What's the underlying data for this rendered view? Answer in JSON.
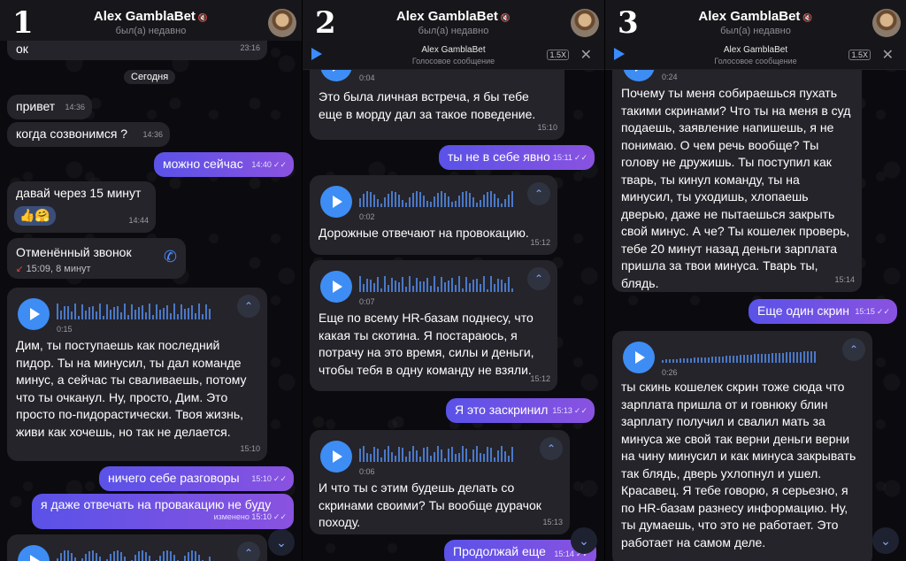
{
  "header": {
    "name": "Alex GamblaBet",
    "status": "был(а) недавно"
  },
  "player": {
    "title": "Alex GamblaBet",
    "subtitle": "Голосовое сообщение",
    "speed": "1.5X"
  },
  "panels": {
    "p1": "1",
    "p2": "2",
    "p3": "3"
  },
  "p1": {
    "m0": {
      "text": "ок",
      "time": "23:16"
    },
    "date": "Сегодня",
    "m1": {
      "text": "привет",
      "time": "14:36"
    },
    "m2": {
      "text": "когда созвонимся ?",
      "time": "14:36"
    },
    "m3": {
      "text": "можно сейчас",
      "time": "14:40"
    },
    "m4": {
      "text": "давай через 15 минут",
      "reactions": "👍🤗",
      "time": "14:44"
    },
    "call": {
      "title": "Отменённый звонок",
      "detail": "15:09, 8 минут"
    },
    "v1": {
      "duration": "0:15",
      "text": "Дим, ты поступаешь как последний пидор. Ты на минусил, ты дал команде минус, а сейчас ты сваливаешь, потому что ты очканул. Ну, просто, Дим. Это просто по-пидорастически. Твоя жизнь, живи как хочешь, но так не делается.",
      "time": "15:10"
    },
    "m5": {
      "text": "ничего себе разговоры",
      "time": "15:10"
    },
    "m6": {
      "text": "я даже отвечать на провакацию не буду",
      "time": "изменено 15:10"
    }
  },
  "p2": {
    "v0": {
      "duration": "0:04",
      "text": "Это была личная встреча, я бы тебе еще в морду дал за такое поведение.",
      "time": "15:10"
    },
    "m1": {
      "text": "ты не в себе явно",
      "time": "15:11"
    },
    "v1": {
      "duration": "0:02",
      "text": "Дорожные отвечают на провокацию.",
      "time": "15:12"
    },
    "v2": {
      "duration": "0:07",
      "text": "Еще по всему HR-базам поднесу, что какая ты скотина. Я постараюсь, я потрачу на это время, силы и деньги, чтобы тебя в одну команду не взяли.",
      "time": "15:12"
    },
    "m2": {
      "text": "Я это заскринил",
      "time": "15:13"
    },
    "v3": {
      "duration": "0:06",
      "text": "И что ты с этим будешь делать со скринами своими? Ты вообще дурачок походу.",
      "time": "15:13"
    },
    "m3": {
      "text": "Продолжай еще",
      "time": "15:14"
    }
  },
  "p3": {
    "v0": {
      "duration": "0:24",
      "text": "Почему ты меня собираешься пухать такими скринами? Что ты на меня в суд подаешь, заявление напишешь, я не понимаю. О чем речь вообще? Ты голову не дружишь. Ты поступил как тварь, ты кинул команду, ты на минусил, ты уходишь, хлопаешь дверью, даже не пытаешься закрыть свой минус. А че? Ты кошелек проверь, тебе 20 минут назад деньги зарплата пришла за твои минуса. Тварь ты, блядь.",
      "time": "15:14"
    },
    "m1": {
      "text": "Еще один скрин",
      "time": "15:15"
    },
    "v1": {
      "duration": "0:26",
      "text": "ты скинь кошелек скрин тоже сюда что зарплата пришла от и говнюку блин зарплату получил и свалил мать за минуса же свой так верни деньги верни на чину минусил и как минуса закрывать так блядь, дверь ухлопнул и ушел. Красавец. Я тебе говорю, я серьезно, я по HR-базам разнесу информацию. Ну, ты думаешь, что это не работает. Это работает на самом деле."
    }
  }
}
